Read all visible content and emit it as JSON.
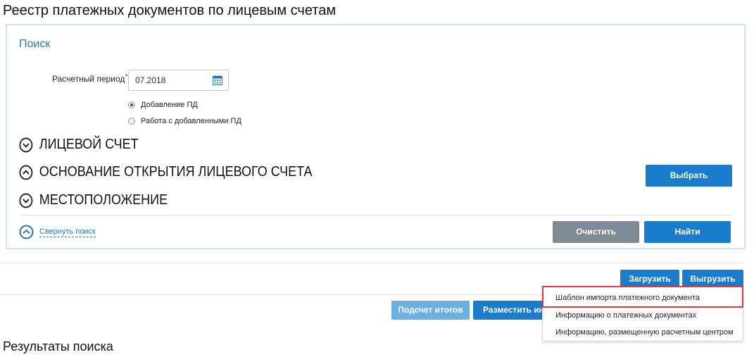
{
  "page_title": "Реестр платежных документов по лицевым счетам",
  "search": {
    "heading": "Поиск",
    "period_label": "Расчетный период",
    "required_mark": "*",
    "period_value": "07.2018",
    "radio_options": [
      {
        "label": "Добавление ПД",
        "selected": true
      },
      {
        "label": "Работа с добавленными ПД",
        "selected": false
      }
    ],
    "sections": [
      {
        "label": "ЛИЦЕВОЙ СЧЕТ",
        "state": "collapsed"
      },
      {
        "label": "ОСНОВАНИЕ ОТКРЫТИЯ ЛИЦЕВОГО СЧЕТА",
        "state": "expanded"
      },
      {
        "label": "МЕСТОПОЛОЖЕНИЕ",
        "state": "collapsed"
      }
    ],
    "select_button": "Выбрать",
    "collapse_link": "Свернуть поиск",
    "clear_button": "Очистить",
    "find_button": "Найти"
  },
  "actions": {
    "upload_button": "Загрузить",
    "export_button": "Выгрузить",
    "totals_button": "Подсчет итогов",
    "place_button": "Разместить инф"
  },
  "export_menu": {
    "items": [
      "Шаблон импорта платежного документа",
      "Информацию о платежных документах",
      "Информацию, размещенную расчетным центром"
    ],
    "highlighted_index": 0
  },
  "results_title": "Результаты поиска",
  "colors": {
    "primary": "#1a7ccc",
    "secondary_gray": "#7e8b95",
    "disabled_blue": "#6cb0e2",
    "link": "#2a76b3",
    "highlight": "#e03a3e"
  }
}
